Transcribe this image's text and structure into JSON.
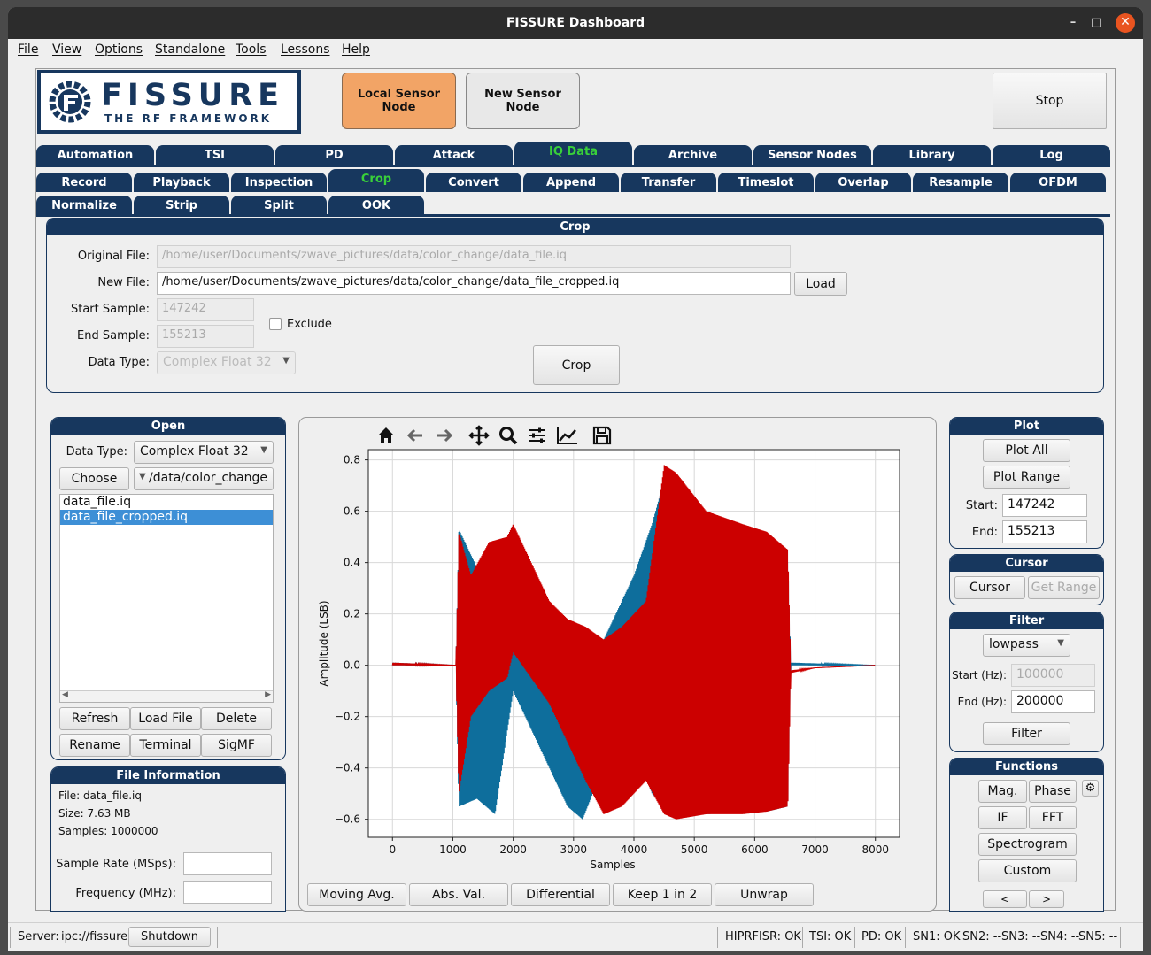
{
  "window": {
    "title": "FISSURE Dashboard"
  },
  "menu": [
    "File",
    "View",
    "Options",
    "Standalone",
    "Tools",
    "Lessons",
    "Help"
  ],
  "logo": {
    "title": "FISSURE",
    "subtitle": "THE RF FRAMEWORK"
  },
  "header": {
    "local_sensor": "Local Sensor Node",
    "new_sensor": "New Sensor Node",
    "stop": "Stop"
  },
  "tabs_main": [
    "Automation",
    "TSI",
    "PD",
    "Attack",
    "IQ Data",
    "Archive",
    "Sensor Nodes",
    "Library",
    "Log"
  ],
  "tabs_iq": [
    "Record",
    "Playback",
    "Inspection",
    "Crop",
    "Convert",
    "Append",
    "Transfer",
    "Timeslot",
    "Overlap",
    "Resample",
    "OFDM"
  ],
  "tabs_iq2": [
    "Normalize",
    "Strip",
    "Split",
    "OOK"
  ],
  "crop": {
    "title": "Crop",
    "original_label": "Original File:",
    "original_value": "/home/user/Documents/zwave_pictures/data/color_change/data_file.iq",
    "new_label": "New File:",
    "new_value": "/home/user/Documents/zwave_pictures/data/color_change/data_file_cropped.iq",
    "load": "Load",
    "start_label": "Start Sample:",
    "start_value": "147242",
    "end_label": "End Sample:",
    "end_value": "155213",
    "exclude": "Exclude",
    "type_label": "Data Type:",
    "type_value": "Complex Float 32",
    "crop_button": "Crop"
  },
  "open": {
    "title": "Open",
    "type_label": "Data Type:",
    "type_value": "Complex Float 32",
    "choose": "Choose",
    "folder": "/data/color_change",
    "files": [
      "data_file.iq",
      "data_file_cropped.iq"
    ],
    "buttons": [
      "Refresh",
      "Load File",
      "Delete",
      "Rename",
      "Terminal",
      "SigMF"
    ]
  },
  "fileinfo": {
    "title": "File Information",
    "file": "File: data_file.iq",
    "size": "Size: 7.63 MB",
    "samples": "Samples: 1000000",
    "rate_label": "Sample Rate (MSps):",
    "freq_label": "Frequency (MHz):"
  },
  "plot_buttons": [
    "Moving Avg.",
    "Abs. Val.",
    "Differential",
    "Keep 1 in 2",
    "Unwrap"
  ],
  "plotpanel": {
    "title": "Plot",
    "plot_all": "Plot All",
    "plot_range": "Plot Range",
    "start_label": "Start:",
    "start_value": "147242",
    "end_label": "End:",
    "end_value": "155213"
  },
  "cursor": {
    "title": "Cursor",
    "cursor": "Cursor",
    "get_range": "Get Range"
  },
  "filter": {
    "title": "Filter",
    "type": "lowpass",
    "start_label": "Start (Hz):",
    "start_value": "100000",
    "end_label": "End (Hz):",
    "end_value": "200000",
    "button": "Filter"
  },
  "functions": {
    "title": "Functions",
    "mag": "Mag.",
    "phase": "Phase",
    "if": "IF",
    "fft": "FFT",
    "spectrogram": "Spectrogram",
    "custom": "Custom",
    "prev": "<",
    "next": ">"
  },
  "status": {
    "server_label": "Server:",
    "server_value": "ipc://fissure",
    "shutdown": "Shutdown",
    "hiprfisr": "HIPRFISR: OK",
    "tsi": "TSI: OK",
    "pd": "PD: OK",
    "sn1": "SN1: OK",
    "sn2": "SN2: --",
    "sn3": "SN3: --",
    "sn4": "SN4: --",
    "sn5": "SN5: --"
  },
  "colors": {
    "navy": "#17375e",
    "orange": "#f0a060",
    "selected_tab_text": "#39d03a",
    "series_i": "#0e6e9c",
    "series_q": "#cc0000",
    "selection": "#3d8fd6"
  },
  "chart_data": {
    "type": "line",
    "xlabel": "Samples",
    "ylabel": "Amplitude (LSB)",
    "xlim": [
      -400,
      8400
    ],
    "ylim": [
      -0.67,
      0.84
    ],
    "xticks": [
      0,
      1000,
      2000,
      3000,
      4000,
      5000,
      6000,
      7000,
      8000
    ],
    "yticks": [
      -0.6,
      -0.4,
      -0.2,
      0.0,
      0.2,
      0.4,
      0.6,
      0.8
    ],
    "ytick_labels": [
      "−0.6",
      "−0.4",
      "−0.2",
      "0.0",
      "0.2",
      "0.4",
      "0.6",
      "0.8"
    ],
    "grid": true,
    "series": [
      {
        "color": "#0e6e9c",
        "envelope": [
          [
            0,
            0.01,
            0.0
          ],
          [
            1050,
            0.0,
            0.0
          ],
          [
            1100,
            0.53,
            -0.55
          ],
          [
            1400,
            0.38,
            -0.52
          ],
          [
            1700,
            0.3,
            -0.58
          ],
          [
            2000,
            0.2,
            -0.1
          ],
          [
            2300,
            0.05,
            -0.25
          ],
          [
            2600,
            -0.05,
            -0.4
          ],
          [
            2900,
            -0.1,
            -0.55
          ],
          [
            3150,
            -0.12,
            -0.6
          ],
          [
            3400,
            0.05,
            -0.45
          ],
          [
            3700,
            0.2,
            -0.35
          ],
          [
            4000,
            0.35,
            -0.3
          ],
          [
            4300,
            0.55,
            -0.5
          ],
          [
            4500,
            0.72,
            -0.55
          ],
          [
            4700,
            0.7,
            -0.58
          ],
          [
            5200,
            0.55,
            -0.58
          ],
          [
            5800,
            0.5,
            -0.57
          ],
          [
            6200,
            0.48,
            -0.57
          ],
          [
            6550,
            0.4,
            -0.55
          ],
          [
            6600,
            0.01,
            0.0
          ],
          [
            8000,
            0.0,
            0.0
          ]
        ]
      },
      {
        "color": "#cc0000",
        "envelope": [
          [
            0,
            0.01,
            0.0
          ],
          [
            1050,
            0.0,
            0.0
          ],
          [
            1100,
            0.52,
            -0.5
          ],
          [
            1300,
            0.35,
            -0.2
          ],
          [
            1600,
            0.48,
            -0.1
          ],
          [
            1900,
            0.5,
            -0.05
          ],
          [
            2000,
            0.55,
            0.05
          ],
          [
            2300,
            0.4,
            -0.05
          ],
          [
            2600,
            0.25,
            -0.15
          ],
          [
            2900,
            0.18,
            -0.3
          ],
          [
            3200,
            0.15,
            -0.45
          ],
          [
            3500,
            0.1,
            -0.58
          ],
          [
            3800,
            0.15,
            -0.55
          ],
          [
            4200,
            0.25,
            -0.45
          ],
          [
            4500,
            0.78,
            -0.58
          ],
          [
            4700,
            0.75,
            -0.6
          ],
          [
            5200,
            0.6,
            -0.58
          ],
          [
            5800,
            0.55,
            -0.58
          ],
          [
            6200,
            0.52,
            -0.57
          ],
          [
            6550,
            0.45,
            -0.55
          ],
          [
            6600,
            -0.02,
            -0.03
          ],
          [
            7000,
            -0.01,
            -0.01
          ],
          [
            8000,
            0.0,
            0.0
          ]
        ]
      }
    ]
  }
}
